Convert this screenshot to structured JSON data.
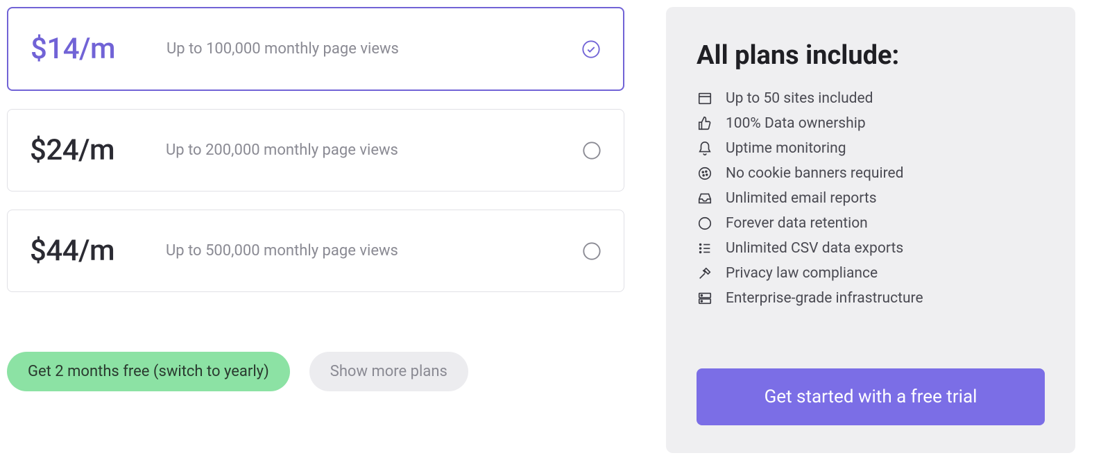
{
  "plans": [
    {
      "price": "$14/m",
      "description": "Up to 100,000 monthly page views",
      "selected": true
    },
    {
      "price": "$24/m",
      "description": "Up to 200,000 monthly page views",
      "selected": false
    },
    {
      "price": "$44/m",
      "description": "Up to 500,000 monthly page views",
      "selected": false
    }
  ],
  "buttons": {
    "yearly_switch": "Get 2 months free (switch to yearly)",
    "show_more": "Show more plans"
  },
  "features_panel": {
    "title": "All plans include:",
    "items": [
      {
        "icon": "window-icon",
        "label": "Up to 50 sites included"
      },
      {
        "icon": "thumbs-up-icon",
        "label": "100% Data ownership"
      },
      {
        "icon": "bell-icon",
        "label": "Uptime monitoring"
      },
      {
        "icon": "cookie-icon",
        "label": "No cookie banners required"
      },
      {
        "icon": "inbox-icon",
        "label": "Unlimited email reports"
      },
      {
        "icon": "circle-icon",
        "label": "Forever data retention"
      },
      {
        "icon": "list-icon",
        "label": "Unlimited CSV data exports"
      },
      {
        "icon": "gavel-icon",
        "label": "Privacy law compliance"
      },
      {
        "icon": "server-icon",
        "label": "Enterprise-grade infrastructure"
      }
    ],
    "cta": "Get started with a free trial"
  },
  "colors": {
    "accent": "#7163d6",
    "cta_bg": "#7b6ee6",
    "pill_green": "#8ce2a4",
    "panel_bg": "#efeff1"
  }
}
